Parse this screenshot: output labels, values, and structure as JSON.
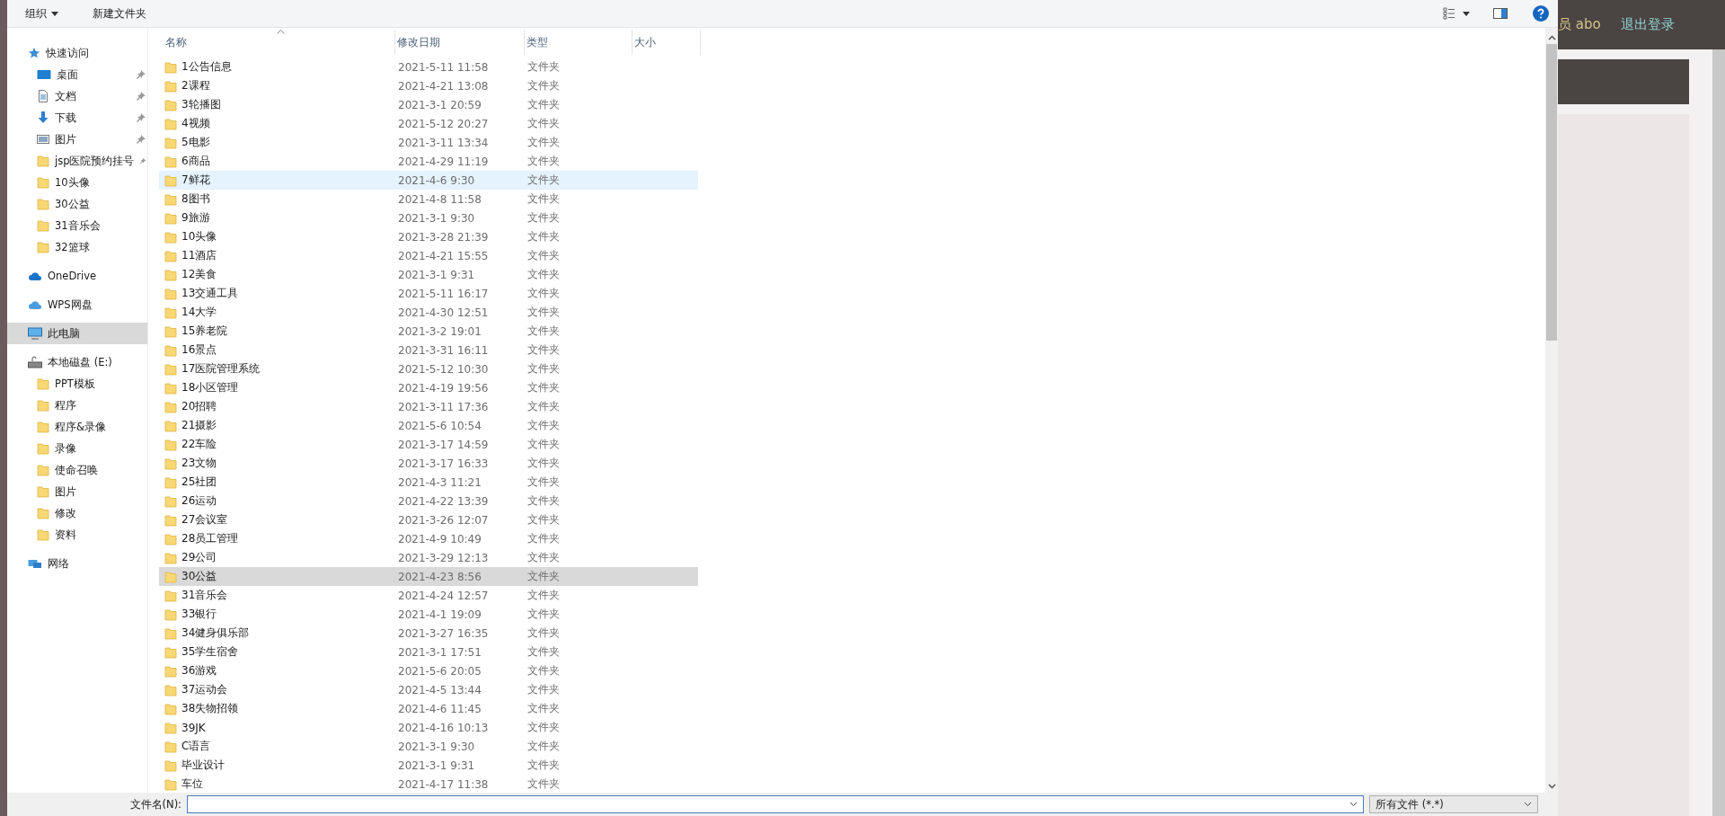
{
  "toolbar": {
    "organize": "组织",
    "new_folder": "新建文件夹"
  },
  "sidebar": [
    {
      "label": "快速访问",
      "kind": "star",
      "selected": false,
      "children": [
        {
          "label": "桌面",
          "kind": "desktop",
          "pinned": true,
          "selected": false
        },
        {
          "label": "文档",
          "kind": "document",
          "pinned": true,
          "selected": false
        },
        {
          "label": "下载",
          "kind": "download",
          "pinned": true,
          "selected": false
        },
        {
          "label": "图片",
          "kind": "pictures",
          "pinned": true,
          "selected": false
        },
        {
          "label": "jsp医院预约挂号",
          "kind": "folder",
          "pinned": true,
          "selected": false
        },
        {
          "label": "10头像",
          "kind": "folder",
          "pinned": false,
          "selected": false
        },
        {
          "label": "30公益",
          "kind": "folder",
          "pinned": false,
          "selected": false
        },
        {
          "label": "31音乐会",
          "kind": "folder",
          "pinned": false,
          "selected": false
        },
        {
          "label": "32篮球",
          "kind": "folder",
          "pinned": false,
          "selected": false
        }
      ]
    },
    {
      "label": "OneDrive",
      "kind": "cloud",
      "selected": false
    },
    {
      "label": "WPS网盘",
      "kind": "cloud2",
      "selected": false
    },
    {
      "label": "此电脑",
      "kind": "pc",
      "selected": true
    },
    {
      "label": "本地磁盘 (E:)",
      "kind": "drive",
      "selected": false,
      "children": [
        {
          "label": "PPT模板",
          "kind": "folder",
          "pinned": false,
          "selected": false
        },
        {
          "label": "程序",
          "kind": "folder",
          "pinned": false,
          "selected": false
        },
        {
          "label": "程序&录像",
          "kind": "folder",
          "pinned": false,
          "selected": false
        },
        {
          "label": "录像",
          "kind": "folder",
          "pinned": false,
          "selected": false
        },
        {
          "label": "使命召唤",
          "kind": "folder",
          "pinned": false,
          "selected": false
        },
        {
          "label": "图片",
          "kind": "folder",
          "pinned": false,
          "selected": false
        },
        {
          "label": "修改",
          "kind": "folder",
          "pinned": false,
          "selected": false
        },
        {
          "label": "资料",
          "kind": "folder",
          "pinned": false,
          "selected": false
        }
      ]
    },
    {
      "label": "网络",
      "kind": "network",
      "selected": false
    }
  ],
  "columns": [
    "名称",
    "修改日期",
    "类型",
    "大小"
  ],
  "rows": [
    {
      "name": "1公告信息",
      "modified": "2021-5-11 11:58",
      "type": "文件夹",
      "selected": false,
      "hover": false
    },
    {
      "name": "2课程",
      "modified": "2021-4-21 13:08",
      "type": "文件夹",
      "selected": false,
      "hover": false
    },
    {
      "name": "3轮播图",
      "modified": "2021-3-1 20:59",
      "type": "文件夹",
      "selected": false,
      "hover": false
    },
    {
      "name": "4视频",
      "modified": "2021-5-12 20:27",
      "type": "文件夹",
      "selected": false,
      "hover": false
    },
    {
      "name": "5电影",
      "modified": "2021-3-11 13:34",
      "type": "文件夹",
      "selected": false,
      "hover": false
    },
    {
      "name": "6商品",
      "modified": "2021-4-29 11:19",
      "type": "文件夹",
      "selected": false,
      "hover": false
    },
    {
      "name": "7鲜花",
      "modified": "2021-4-6 9:30",
      "type": "文件夹",
      "selected": false,
      "hover": true
    },
    {
      "name": "8图书",
      "modified": "2021-4-8 11:58",
      "type": "文件夹",
      "selected": false,
      "hover": false
    },
    {
      "name": "9旅游",
      "modified": "2021-3-1 9:30",
      "type": "文件夹",
      "selected": false,
      "hover": false
    },
    {
      "name": "10头像",
      "modified": "2021-3-28 21:39",
      "type": "文件夹",
      "selected": false,
      "hover": false
    },
    {
      "name": "11酒店",
      "modified": "2021-4-21 15:55",
      "type": "文件夹",
      "selected": false,
      "hover": false
    },
    {
      "name": "12美食",
      "modified": "2021-3-1 9:31",
      "type": "文件夹",
      "selected": false,
      "hover": false
    },
    {
      "name": "13交通工具",
      "modified": "2021-5-11 16:17",
      "type": "文件夹",
      "selected": false,
      "hover": false
    },
    {
      "name": "14大学",
      "modified": "2021-4-30 12:51",
      "type": "文件夹",
      "selected": false,
      "hover": false
    },
    {
      "name": "15养老院",
      "modified": "2021-3-2 19:01",
      "type": "文件夹",
      "selected": false,
      "hover": false
    },
    {
      "name": "16景点",
      "modified": "2021-3-31 16:11",
      "type": "文件夹",
      "selected": false,
      "hover": false
    },
    {
      "name": "17医院管理系统",
      "modified": "2021-5-12 10:30",
      "type": "文件夹",
      "selected": false,
      "hover": false
    },
    {
      "name": "18小区管理",
      "modified": "2021-4-19 19:56",
      "type": "文件夹",
      "selected": false,
      "hover": false
    },
    {
      "name": "20招聘",
      "modified": "2021-3-11 17:36",
      "type": "文件夹",
      "selected": false,
      "hover": false
    },
    {
      "name": "21摄影",
      "modified": "2021-5-6 10:54",
      "type": "文件夹",
      "selected": false,
      "hover": false
    },
    {
      "name": "22车险",
      "modified": "2021-3-17 14:59",
      "type": "文件夹",
      "selected": false,
      "hover": false
    },
    {
      "name": "23文物",
      "modified": "2021-3-17 16:33",
      "type": "文件夹",
      "selected": false,
      "hover": false
    },
    {
      "name": "25社团",
      "modified": "2021-4-3 11:21",
      "type": "文件夹",
      "selected": false,
      "hover": false
    },
    {
      "name": "26运动",
      "modified": "2021-4-22 13:39",
      "type": "文件夹",
      "selected": false,
      "hover": false
    },
    {
      "name": "27会议室",
      "modified": "2021-3-26 12:07",
      "type": "文件夹",
      "selected": false,
      "hover": false
    },
    {
      "name": "28员工管理",
      "modified": "2021-4-9 10:49",
      "type": "文件夹",
      "selected": false,
      "hover": false
    },
    {
      "name": "29公司",
      "modified": "2021-3-29 12:13",
      "type": "文件夹",
      "selected": false,
      "hover": false
    },
    {
      "name": "30公益",
      "modified": "2021-4-23 8:56",
      "type": "文件夹",
      "selected": true,
      "hover": false
    },
    {
      "name": "31音乐会",
      "modified": "2021-4-24 12:57",
      "type": "文件夹",
      "selected": false,
      "hover": false
    },
    {
      "name": "33银行",
      "modified": "2021-4-1 19:09",
      "type": "文件夹",
      "selected": false,
      "hover": false
    },
    {
      "name": "34健身俱乐部",
      "modified": "2021-3-27 16:35",
      "type": "文件夹",
      "selected": false,
      "hover": false
    },
    {
      "name": "35学生宿舍",
      "modified": "2021-3-1 17:51",
      "type": "文件夹",
      "selected": false,
      "hover": false
    },
    {
      "name": "36游戏",
      "modified": "2021-5-6 20:05",
      "type": "文件夹",
      "selected": false,
      "hover": false
    },
    {
      "name": "37运动会",
      "modified": "2021-4-5 13:44",
      "type": "文件夹",
      "selected": false,
      "hover": false
    },
    {
      "name": "38失物招领",
      "modified": "2021-4-6 11:45",
      "type": "文件夹",
      "selected": false,
      "hover": false
    },
    {
      "name": "39JK",
      "modified": "2021-4-16 10:13",
      "type": "文件夹",
      "selected": false,
      "hover": false
    },
    {
      "name": "C语言",
      "modified": "2021-3-1 9:30",
      "type": "文件夹",
      "selected": false,
      "hover": false
    },
    {
      "name": "毕业设计",
      "modified": "2021-3-1 9:31",
      "type": "文件夹",
      "selected": false,
      "hover": false
    },
    {
      "name": "车位",
      "modified": "2021-4-17 11:38",
      "type": "文件夹",
      "selected": false,
      "hover": false
    }
  ],
  "filename": {
    "label": "文件名(N):"
  },
  "filter": "所有文件 (*.*)",
  "page": {
    "user": "员 abo",
    "logout": "退出登录"
  }
}
